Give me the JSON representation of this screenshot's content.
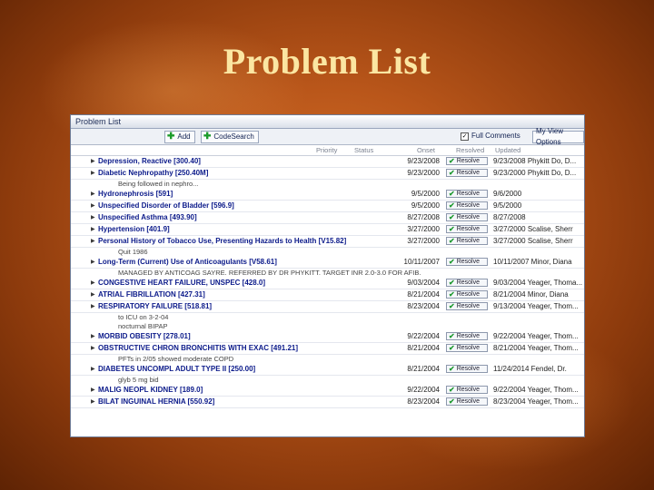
{
  "slide": {
    "title": "Problem List"
  },
  "window": {
    "title": "Problem List"
  },
  "toolbar": {
    "add_label": "Add",
    "code_search_label": "CodeSearch",
    "full_comments_label": "Full Comments",
    "view_options_label": "My View Options"
  },
  "headers": {
    "priority": "Priority",
    "status": "Status",
    "onset": "Onset",
    "resolved": "Resolved",
    "updated": "Updated"
  },
  "resolve_label": "Resolve",
  "problems": [
    {
      "name": "Depression, Reactive [300.40]",
      "onset": "9/23/2008",
      "updated": "9/23/2008 Phykitt Do, D...",
      "subs": []
    },
    {
      "name": "Diabetic Nephropathy [250.40M]",
      "onset": "9/23/2000",
      "updated": "9/23/2000 Phykitt Do, D...",
      "subs": [
        "Being followed in nephro..."
      ]
    },
    {
      "name": "Hydronephrosis [591]",
      "onset": "9/5/2000",
      "updated": "9/6/2000",
      "subs": []
    },
    {
      "name": "Unspecified Disorder of Bladder [596.9]",
      "onset": "9/5/2000",
      "updated": "9/5/2000",
      "subs": []
    },
    {
      "name": "Unspecified Asthma [493.90]",
      "onset": "8/27/2008",
      "updated": "8/27/2008",
      "subs": []
    },
    {
      "name": "Hypertension [401.9]",
      "onset": "3/27/2000",
      "updated": "3/27/2000 Scalise, Sherr",
      "subs": []
    },
    {
      "name": "Personal History of Tobacco Use, Presenting Hazards to Health [V15.82]",
      "onset": "3/27/2000",
      "updated": "3/27/2000 Scalise, Sherr",
      "subs": [
        "Quit 1986"
      ]
    },
    {
      "name": "Long-Term (Current) Use of Anticoagulants [V58.61]",
      "onset": "10/11/2007",
      "updated": "10/11/2007 Minor, Diana",
      "subs": [
        "MANAGED BY ANTICOAG SAYRE. REFERRED BY DR PHYKITT. TARGET INR 2.0-3.0 FOR AFIB."
      ]
    },
    {
      "name": "CONGESTIVE HEART FAILURE, UNSPEC [428.0]",
      "onset": "9/03/2004",
      "updated": "9/03/2004 Yeager, Thoma...",
      "subs": []
    },
    {
      "name": "ATRIAL FIBRILLATION [427.31]",
      "onset": "8/21/2004",
      "updated": "8/21/2004 Minor, Diana",
      "subs": []
    },
    {
      "name": "RESPIRATORY FAILURE [518.81]",
      "onset": "8/23/2004",
      "updated": "9/13/2004 Yeager, Thom...",
      "subs": [
        "to ICU on 3-2-04",
        "nocturnal BIPAP"
      ]
    },
    {
      "name": "MORBID OBESITY [278.01]",
      "onset": "9/22/2004",
      "updated": "9/22/2004 Yeager, Thom...",
      "subs": []
    },
    {
      "name": "OBSTRUCTIVE CHRON BRONCHITIS WITH EXAC [491.21]",
      "onset": "8/21/2004",
      "updated": "8/21/2004 Yeager, Thom...",
      "subs": [
        "PFTs in 2/05 showed moderate COPD"
      ]
    },
    {
      "name": "DIABETES UNCOMPL ADULT TYPE II [250.00]",
      "onset": "8/21/2004",
      "updated": "11/24/2014 Fendel, Dr.",
      "subs": [
        "glyb 5 mg bid"
      ]
    },
    {
      "name": "MALIG NEOPL KIDNEY [189.0]",
      "onset": "9/22/2004",
      "updated": "9/22/2004 Yeager, Thom...",
      "subs": []
    },
    {
      "name": "BILAT INGUINAL HERNIA [550.92]",
      "onset": "8/23/2004",
      "updated": "8/23/2004 Yeager, Thom...",
      "subs": []
    }
  ],
  "colors": {
    "slide_bg": "#b9561a",
    "title": "#fbe6a2",
    "problem_text": "#0b1a8a"
  }
}
